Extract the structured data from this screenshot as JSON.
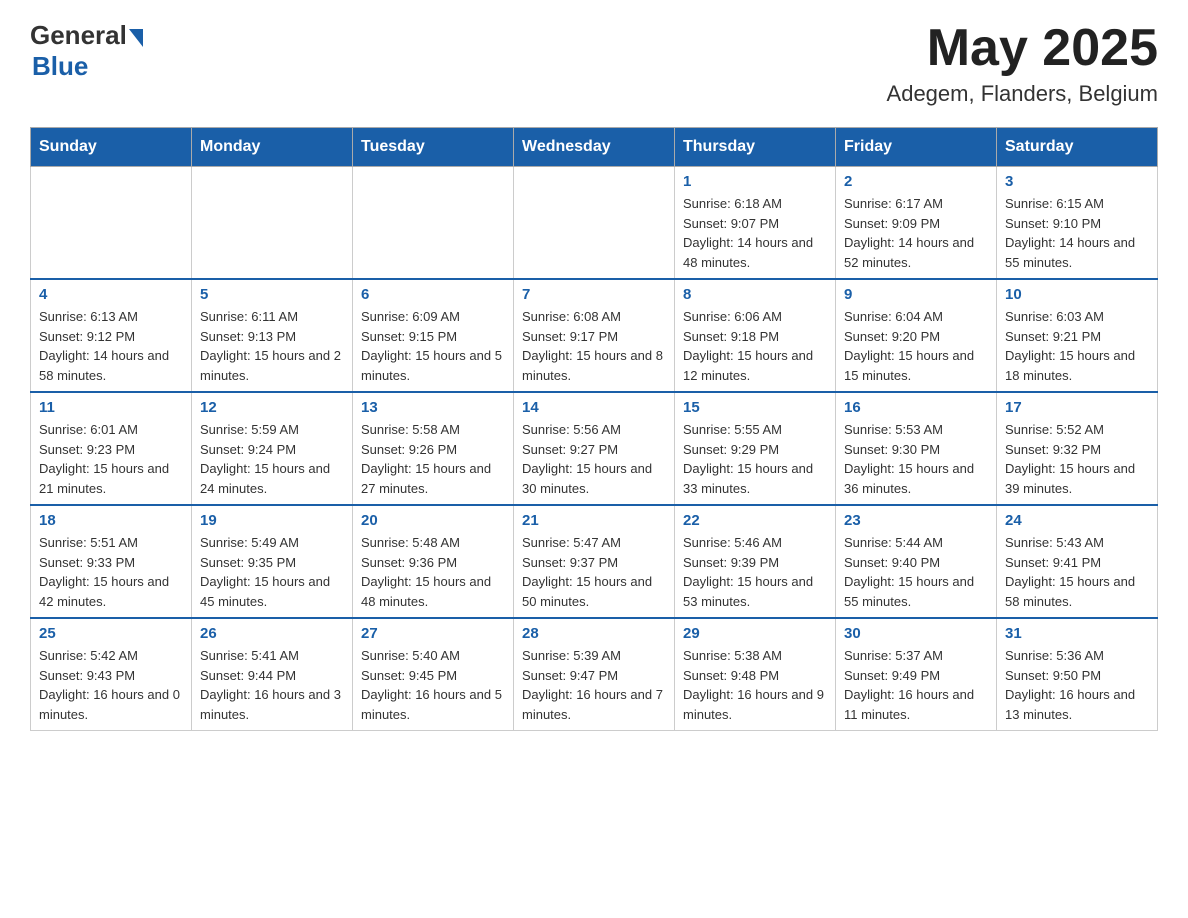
{
  "header": {
    "logo_general": "General",
    "logo_blue": "Blue",
    "month_year": "May 2025",
    "location": "Adegem, Flanders, Belgium"
  },
  "weekdays": [
    "Sunday",
    "Monday",
    "Tuesday",
    "Wednesday",
    "Thursday",
    "Friday",
    "Saturday"
  ],
  "weeks": [
    [
      {
        "day": "",
        "info": ""
      },
      {
        "day": "",
        "info": ""
      },
      {
        "day": "",
        "info": ""
      },
      {
        "day": "",
        "info": ""
      },
      {
        "day": "1",
        "info": "Sunrise: 6:18 AM\nSunset: 9:07 PM\nDaylight: 14 hours and 48 minutes."
      },
      {
        "day": "2",
        "info": "Sunrise: 6:17 AM\nSunset: 9:09 PM\nDaylight: 14 hours and 52 minutes."
      },
      {
        "day": "3",
        "info": "Sunrise: 6:15 AM\nSunset: 9:10 PM\nDaylight: 14 hours and 55 minutes."
      }
    ],
    [
      {
        "day": "4",
        "info": "Sunrise: 6:13 AM\nSunset: 9:12 PM\nDaylight: 14 hours and 58 minutes."
      },
      {
        "day": "5",
        "info": "Sunrise: 6:11 AM\nSunset: 9:13 PM\nDaylight: 15 hours and 2 minutes."
      },
      {
        "day": "6",
        "info": "Sunrise: 6:09 AM\nSunset: 9:15 PM\nDaylight: 15 hours and 5 minutes."
      },
      {
        "day": "7",
        "info": "Sunrise: 6:08 AM\nSunset: 9:17 PM\nDaylight: 15 hours and 8 minutes."
      },
      {
        "day": "8",
        "info": "Sunrise: 6:06 AM\nSunset: 9:18 PM\nDaylight: 15 hours and 12 minutes."
      },
      {
        "day": "9",
        "info": "Sunrise: 6:04 AM\nSunset: 9:20 PM\nDaylight: 15 hours and 15 minutes."
      },
      {
        "day": "10",
        "info": "Sunrise: 6:03 AM\nSunset: 9:21 PM\nDaylight: 15 hours and 18 minutes."
      }
    ],
    [
      {
        "day": "11",
        "info": "Sunrise: 6:01 AM\nSunset: 9:23 PM\nDaylight: 15 hours and 21 minutes."
      },
      {
        "day": "12",
        "info": "Sunrise: 5:59 AM\nSunset: 9:24 PM\nDaylight: 15 hours and 24 minutes."
      },
      {
        "day": "13",
        "info": "Sunrise: 5:58 AM\nSunset: 9:26 PM\nDaylight: 15 hours and 27 minutes."
      },
      {
        "day": "14",
        "info": "Sunrise: 5:56 AM\nSunset: 9:27 PM\nDaylight: 15 hours and 30 minutes."
      },
      {
        "day": "15",
        "info": "Sunrise: 5:55 AM\nSunset: 9:29 PM\nDaylight: 15 hours and 33 minutes."
      },
      {
        "day": "16",
        "info": "Sunrise: 5:53 AM\nSunset: 9:30 PM\nDaylight: 15 hours and 36 minutes."
      },
      {
        "day": "17",
        "info": "Sunrise: 5:52 AM\nSunset: 9:32 PM\nDaylight: 15 hours and 39 minutes."
      }
    ],
    [
      {
        "day": "18",
        "info": "Sunrise: 5:51 AM\nSunset: 9:33 PM\nDaylight: 15 hours and 42 minutes."
      },
      {
        "day": "19",
        "info": "Sunrise: 5:49 AM\nSunset: 9:35 PM\nDaylight: 15 hours and 45 minutes."
      },
      {
        "day": "20",
        "info": "Sunrise: 5:48 AM\nSunset: 9:36 PM\nDaylight: 15 hours and 48 minutes."
      },
      {
        "day": "21",
        "info": "Sunrise: 5:47 AM\nSunset: 9:37 PM\nDaylight: 15 hours and 50 minutes."
      },
      {
        "day": "22",
        "info": "Sunrise: 5:46 AM\nSunset: 9:39 PM\nDaylight: 15 hours and 53 minutes."
      },
      {
        "day": "23",
        "info": "Sunrise: 5:44 AM\nSunset: 9:40 PM\nDaylight: 15 hours and 55 minutes."
      },
      {
        "day": "24",
        "info": "Sunrise: 5:43 AM\nSunset: 9:41 PM\nDaylight: 15 hours and 58 minutes."
      }
    ],
    [
      {
        "day": "25",
        "info": "Sunrise: 5:42 AM\nSunset: 9:43 PM\nDaylight: 16 hours and 0 minutes."
      },
      {
        "day": "26",
        "info": "Sunrise: 5:41 AM\nSunset: 9:44 PM\nDaylight: 16 hours and 3 minutes."
      },
      {
        "day": "27",
        "info": "Sunrise: 5:40 AM\nSunset: 9:45 PM\nDaylight: 16 hours and 5 minutes."
      },
      {
        "day": "28",
        "info": "Sunrise: 5:39 AM\nSunset: 9:47 PM\nDaylight: 16 hours and 7 minutes."
      },
      {
        "day": "29",
        "info": "Sunrise: 5:38 AM\nSunset: 9:48 PM\nDaylight: 16 hours and 9 minutes."
      },
      {
        "day": "30",
        "info": "Sunrise: 5:37 AM\nSunset: 9:49 PM\nDaylight: 16 hours and 11 minutes."
      },
      {
        "day": "31",
        "info": "Sunrise: 5:36 AM\nSunset: 9:50 PM\nDaylight: 16 hours and 13 minutes."
      }
    ]
  ]
}
